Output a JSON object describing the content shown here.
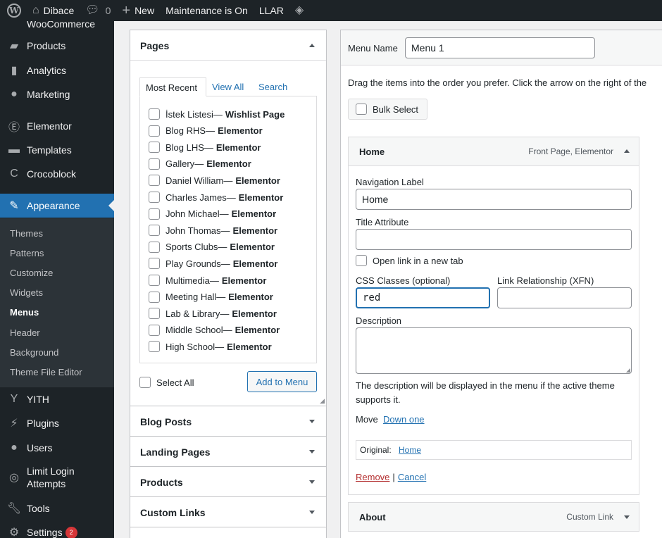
{
  "admin_bar": {
    "site_name": "Dibace",
    "comments_count": "0",
    "new_label": "New",
    "maintenance_label": "Maintenance is On",
    "llar_label": "LLAR"
  },
  "sidebar": {
    "items": [
      {
        "label": "WooCommerce",
        "icon": "woocommerce-icon"
      },
      {
        "label": "Products",
        "icon": "archive-icon"
      },
      {
        "label": "Analytics",
        "icon": "bar-chart-icon"
      },
      {
        "label": "Marketing",
        "icon": "megaphone-icon"
      },
      {
        "label": "Elementor",
        "icon": "elementor-icon"
      },
      {
        "label": "Templates",
        "icon": "folder-icon"
      },
      {
        "label": "Crocoblock",
        "icon": "crocoblock-icon"
      },
      {
        "label": "Appearance",
        "icon": "paintbrush-icon"
      },
      {
        "label": "YITH",
        "icon": "yith-icon"
      },
      {
        "label": "Plugins",
        "icon": "plug-icon"
      },
      {
        "label": "Users",
        "icon": "user-icon"
      },
      {
        "label": "Limit Login Attempts",
        "icon": "fingerprint-icon"
      },
      {
        "label": "Tools",
        "icon": "wrench-icon"
      },
      {
        "label": "Settings",
        "icon": "settings-icon",
        "badge": "2"
      }
    ],
    "submenu": [
      "Themes",
      "Patterns",
      "Customize",
      "Widgets",
      "Menus",
      "Header",
      "Background",
      "Theme File Editor"
    ]
  },
  "add_items": {
    "pages_title": "Pages",
    "tabs": [
      "Most Recent",
      "View All",
      "Search"
    ],
    "pages": [
      {
        "name": "İstek Listesi",
        "type": "Wishlist Page"
      },
      {
        "name": "Blog RHS",
        "type": "Elementor"
      },
      {
        "name": "Blog LHS",
        "type": "Elementor"
      },
      {
        "name": "Gallery",
        "type": "Elementor"
      },
      {
        "name": "Daniel William",
        "type": "Elementor"
      },
      {
        "name": "Charles James",
        "type": "Elementor"
      },
      {
        "name": "John Michael",
        "type": "Elementor"
      },
      {
        "name": "John Thomas",
        "type": "Elementor"
      },
      {
        "name": "Sports Clubs",
        "type": "Elementor"
      },
      {
        "name": "Play Grounds",
        "type": "Elementor"
      },
      {
        "name": "Multimedia",
        "type": "Elementor"
      },
      {
        "name": "Meeting Hall",
        "type": "Elementor"
      },
      {
        "name": "Lab & Library",
        "type": "Elementor"
      },
      {
        "name": "Middle School",
        "type": "Elementor"
      },
      {
        "name": "High School",
        "type": "Elementor"
      }
    ],
    "separator": " —",
    "select_all": "Select All",
    "add_to_menu": "Add to Menu",
    "other_sections": [
      "Blog Posts",
      "Landing Pages",
      "Products",
      "Custom Links"
    ]
  },
  "menu": {
    "name_label": "Menu Name",
    "name_value": "Menu 1",
    "instructions": "Drag the items into the order you prefer. Click the arrow on the right of the",
    "bulk_select": "Bulk Select",
    "items": [
      {
        "title": "Home",
        "meta": "Front Page, Elementor",
        "nav_label_label": "Navigation Label",
        "nav_label_value": "Home",
        "title_attr_label": "Title Attribute",
        "title_attr_value": "",
        "new_tab_label": "Open link in a new tab",
        "css_label": "CSS Classes (optional)",
        "css_value": "red",
        "xfn_label": "Link Relationship (XFN)",
        "xfn_value": "",
        "desc_label": "Description",
        "desc_value": "",
        "desc_note_1": "The description will be displayed in the menu if the active theme",
        "desc_note_2": "supports it.",
        "move_label": "Move",
        "move_link": "Down one",
        "original_label": "Original:",
        "original_link": "Home",
        "remove": "Remove",
        "sep": "|",
        "cancel": "Cancel"
      },
      {
        "title": "About",
        "meta": "Custom Link"
      }
    ]
  }
}
